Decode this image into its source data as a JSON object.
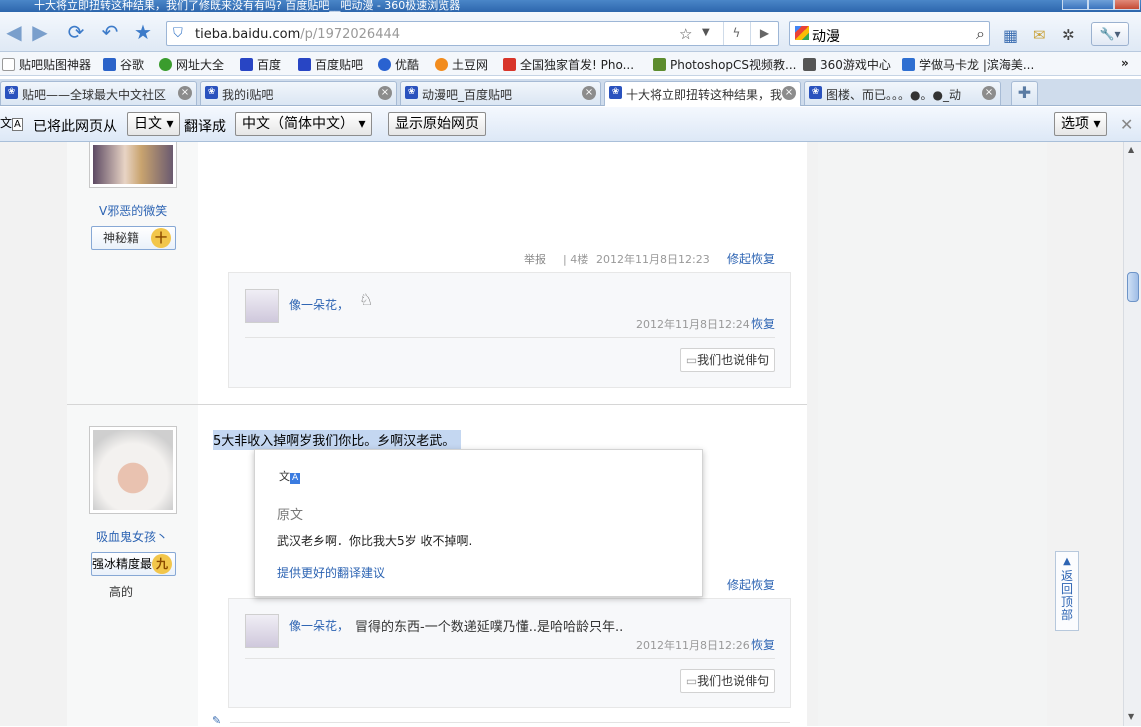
{
  "window": {
    "title": "十大将立即扭转这种结果，我们了修既来没有有吗? 百度贴吧__吧动漫 - 360极速浏览器"
  },
  "address": {
    "domain": "tieba.baidu.com",
    "path": "/p/1972026444"
  },
  "search": {
    "value": "动漫"
  },
  "bookmarks": [
    "贴吧贴图神器",
    "谷歌",
    "网址大全",
    "百度",
    "百度贴吧",
    "优酷",
    "土豆网",
    "全国独家首发! Pho...",
    "PhotoshopCS视频教...",
    "360游戏中心",
    "学做马卡龙 |滨海美..."
  ],
  "tabs": [
    {
      "label": "贴吧——全球最大中文社区"
    },
    {
      "label": "我的i贴吧"
    },
    {
      "label": "动漫吧_百度贴吧"
    },
    {
      "label": "十大将立即扭转这种结果，我"
    },
    {
      "label": "图楼、而已。。。●。●_动"
    }
  ],
  "translate_bar": {
    "prefix": "已将此网页从",
    "from_lang": "日文",
    "middle": "翻译成",
    "to_lang": "中文（简体中文）",
    "show_original": "显示原始网页",
    "options": "选项"
  },
  "post1": {
    "username": "V邪恶的微笑",
    "badge": "神秘籍",
    "badge_level": "十",
    "report": "举报",
    "floor": "4楼",
    "time": "2012年11月8日12:23",
    "collapse": "修起恢复",
    "reply": {
      "user": "像一朵花，",
      "time": "2012年11月8日12:24",
      "action": "恢复"
    },
    "say_button": "我们也说俳句"
  },
  "post2": {
    "username": "吸血鬼女孩丶",
    "badge": "强冰精度最",
    "badge_level": "九",
    "badge_extra": "高的",
    "text": "5大非收入掉啊岁我们你比。乡啊汉老武。",
    "collapse": "修起恢复",
    "reply": {
      "user": "像一朵花，",
      "text": "冒得的东西-一个数递延噗乃懂..是哈哈龄只年..",
      "time": "2012年11月8日12:26",
      "action": "恢复"
    },
    "say_button": "我们也说俳句"
  },
  "popup": {
    "heading": "原文",
    "original": "武汉老乡啊．你比我大5岁 收不掉啊.",
    "suggest": "提供更好的翻译建议"
  },
  "back_to_top": "返回顶部"
}
